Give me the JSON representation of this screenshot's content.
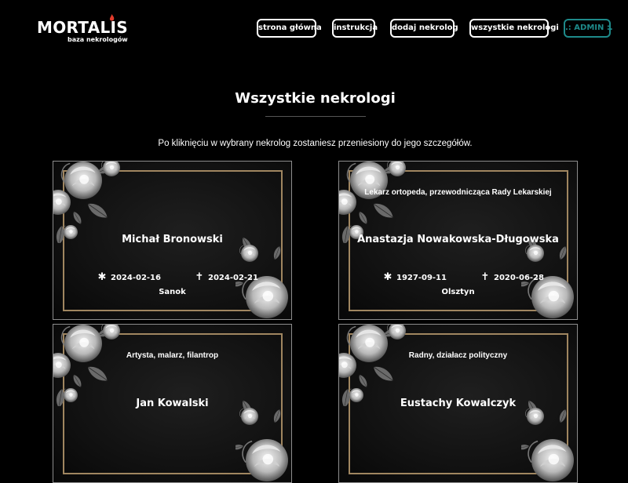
{
  "header": {
    "logo_title": "MORTALIS",
    "logo_subtitle": "baza nekrologów",
    "nav": {
      "home": "strona główna",
      "instructions": "instrukcja",
      "add": "dodaj nekrolog",
      "all": "wszystkie nekrologi",
      "admin": ".: ADMIN :."
    }
  },
  "page": {
    "title": "Wszystkie nekrologi",
    "subtitle": "Po kliknięciu w wybrany nekrolog zostaniesz przeniesiony do jego szczegółów."
  },
  "icons": {
    "birth": "asterisk-icon",
    "death": "cross-icon"
  },
  "symbols": {
    "birth": "✱",
    "death": "✝"
  },
  "colors": {
    "background": "#000000",
    "frame_gold": "#a08660",
    "admin_accent": "#1e8a8a"
  },
  "obituaries": [
    {
      "role": "",
      "name": "Michał Bronowski",
      "birth": "2024-02-16",
      "death": "2024-02-21",
      "place": "Sanok"
    },
    {
      "role": "Lekarz ortopeda, przewodnicząca Rady Lekarskiej",
      "name": "Anastazja Nowakowska-Długowska",
      "birth": "1927-09-11",
      "death": "2020-06-28",
      "place": "Olsztyn"
    },
    {
      "role": "Artysta, malarz, filantrop",
      "name": "Jan Kowalski",
      "birth": "",
      "death": "",
      "place": ""
    },
    {
      "role": "Radny, działacz polityczny",
      "name": "Eustachy Kowalczyk",
      "birth": "",
      "death": "",
      "place": ""
    }
  ]
}
